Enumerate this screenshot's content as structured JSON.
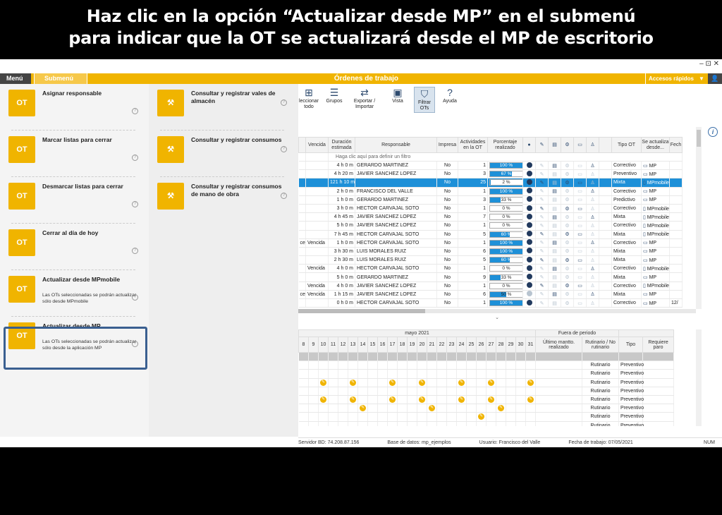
{
  "banner": {
    "line1": "Haz clic en la opción “Actualizar desde MP” en el submenú",
    "line2": "para indicar que la OT se actualizará desde el MP de escritorio"
  },
  "window": {
    "controls": "– ⊡ ✕"
  },
  "menubar": {
    "menu": "Menú",
    "submenu": "Submenú",
    "title": "Órdenes de trabajo",
    "quick": "Accesos rápidos"
  },
  "submenu": {
    "col1": [
      {
        "icon": "OT",
        "label": "Asignar responsable",
        "desc": ""
      },
      {
        "icon": "OT",
        "label": "Marcar listas para cerrar",
        "desc": ""
      },
      {
        "icon": "OT",
        "label": "Desmarcar listas para cerrar",
        "desc": ""
      },
      {
        "icon": "OT",
        "label": "Cerrar al día de hoy",
        "desc": ""
      },
      {
        "icon": "OT",
        "label": "Actualizar desde MPmobile",
        "desc": "Las OTs seleccionadas se podrán actualizar sólo desde MPmobile"
      },
      {
        "icon": "OT",
        "label": "Actualizar desde MP",
        "desc": "Las OTs seleccionadas se podrán actualizar sólo desde la aplicación MP"
      }
    ],
    "col2": [
      {
        "label": "Consultar y registrar vales de almacén"
      },
      {
        "label": "Consultar y registrar consumos"
      },
      {
        "label": "Consultar y registrar consumos de mano de obra"
      }
    ],
    "help": "?"
  },
  "toolbar": {
    "items": [
      {
        "label": "leccionar todo",
        "glyph": "⊞"
      },
      {
        "label": "Grupos",
        "glyph": "☰"
      },
      {
        "label": "Exportar / Importar",
        "glyph": "⇄"
      },
      {
        "label": "Vista",
        "glyph": "▣"
      },
      {
        "label": "Filtrar OTs",
        "glyph": "⛉"
      },
      {
        "label": "Ayuda",
        "glyph": "?"
      }
    ]
  },
  "grid": {
    "headers": [
      "Vencida",
      "Duración estimada",
      "Responsable",
      "Impresa",
      "Actividades en la OT",
      "Porcentaje realizado",
      "Tipo OT",
      "Se actualiza desde...",
      "Fech"
    ],
    "filter_text": "Haga clic aquí para definir un filtro",
    "rows": [
      {
        "pre": "",
        "venc": "",
        "dur": "4 h 0 m",
        "resp": "GERARDO MARTINEZ",
        "imp": "No",
        "act": "1",
        "pct": "100 %",
        "fill": 100,
        "tipo": "Correctivo",
        "desde": "MP",
        "fecha": ""
      },
      {
        "pre": "",
        "venc": "",
        "dur": "4 h 20 m",
        "resp": "JAVIER SANCHEZ LOPEZ",
        "imp": "No",
        "act": "3",
        "pct": "67 %",
        "fill": 67,
        "tipo": "Preventivo",
        "desde": "MP",
        "fecha": ""
      },
      {
        "pre": "",
        "venc": "",
        "dur": "121 h 10 m",
        "resp": "",
        "imp": "No",
        "act": "25",
        "pct": "2 %",
        "fill": 2,
        "tipo": "Mixta",
        "desde": "MPmobile",
        "fecha": "",
        "hl": true
      },
      {
        "pre": "",
        "venc": "",
        "dur": "2 h 0 m",
        "resp": "FRANCISCO DEL VALLE",
        "imp": "No",
        "act": "1",
        "pct": "100 %",
        "fill": 100,
        "tipo": "Correctivo",
        "desde": "MP",
        "fecha": ""
      },
      {
        "pre": "",
        "venc": "",
        "dur": "1 h 0 m",
        "resp": "GERARDO MARTINEZ",
        "imp": "No",
        "act": "3",
        "pct": "33 %",
        "fill": 33,
        "tipo": "Predictivo",
        "desde": "MP",
        "fecha": ""
      },
      {
        "pre": "",
        "venc": "",
        "dur": "3 h 0 m",
        "resp": "HECTOR CARVAJAL SOTO",
        "imp": "No",
        "act": "1",
        "pct": "0 %",
        "fill": 0,
        "tipo": "Correctivo",
        "desde": "MPmobile",
        "fecha": ""
      },
      {
        "pre": "",
        "venc": "",
        "dur": "4 h 45 m",
        "resp": "JAVIER SANCHEZ LOPEZ",
        "imp": "No",
        "act": "7",
        "pct": "0 %",
        "fill": 0,
        "tipo": "Mixta",
        "desde": "MPmobile",
        "fecha": ""
      },
      {
        "pre": "",
        "venc": "",
        "dur": "5 h 0 m",
        "resp": "JAVIER SANCHEZ LOPEZ",
        "imp": "No",
        "act": "1",
        "pct": "0 %",
        "fill": 0,
        "tipo": "Correctivo",
        "desde": "MPmobile",
        "fecha": ""
      },
      {
        "pre": "",
        "venc": "",
        "dur": "7 h 45 m",
        "resp": "HECTOR CARVAJAL SOTO",
        "imp": "No",
        "act": "5",
        "pct": "60 %",
        "fill": 60,
        "tipo": "Mixta",
        "desde": "MPmobile",
        "fecha": ""
      },
      {
        "pre": "ce",
        "venc": "Vencida",
        "dur": "1 h 0 m",
        "resp": "HECTOR CARVAJAL SOTO",
        "imp": "No",
        "act": "1",
        "pct": "100 %",
        "fill": 100,
        "tipo": "Correctivo",
        "desde": "MP",
        "fecha": ""
      },
      {
        "pre": "",
        "venc": "",
        "dur": "3 h 30 m",
        "resp": "LUIS MORALES RUIZ",
        "imp": "No",
        "act": "6",
        "pct": "100 %",
        "fill": 100,
        "tipo": "Mixta",
        "desde": "MP",
        "fecha": ""
      },
      {
        "pre": "",
        "venc": "",
        "dur": "2 h 30 m",
        "resp": "LUIS MORALES RUIZ",
        "imp": "No",
        "act": "5",
        "pct": "60 %",
        "fill": 60,
        "tipo": "Mixta",
        "desde": "MP",
        "fecha": ""
      },
      {
        "pre": "",
        "venc": "Vencida",
        "dur": "4 h 0 m",
        "resp": "HECTOR CARVAJAL SOTO",
        "imp": "No",
        "act": "1",
        "pct": "0 %",
        "fill": 0,
        "tipo": "Correctivo",
        "desde": "MPmobile",
        "fecha": ""
      },
      {
        "pre": "",
        "venc": "",
        "dur": "5 h 0 m",
        "resp": "GERARDO MARTINEZ",
        "imp": "No",
        "act": "9",
        "pct": "33 %",
        "fill": 33,
        "tipo": "Mixta",
        "desde": "MP",
        "fecha": ""
      },
      {
        "pre": "",
        "venc": "Vencida",
        "dur": "4 h 0 m",
        "resp": "JAVIER SANCHEZ LOPEZ",
        "imp": "No",
        "act": "1",
        "pct": "0 %",
        "fill": 0,
        "tipo": "Correctivo",
        "desde": "MPmobile",
        "fecha": ""
      },
      {
        "pre": "ce",
        "venc": "Vencida",
        "dur": "1 h 15 m",
        "resp": "JAVIER SANCHEZ LOPEZ",
        "imp": "No",
        "act": "6",
        "pct": "50 %",
        "fill": 50,
        "tipo": "Mixta",
        "desde": "MP",
        "fecha": ""
      },
      {
        "pre": "",
        "venc": "",
        "dur": "0 h 0 m",
        "resp": "HECTOR CARVAJAL SOTO",
        "imp": "No",
        "act": "1",
        "pct": "100 %",
        "fill": 100,
        "tipo": "Correctivo",
        "desde": "MP",
        "fecha": "12/"
      }
    ]
  },
  "calendar": {
    "month": "mayo 2021",
    "out_of_period": "Fuera de periodo",
    "days": [
      "8",
      "9",
      "10",
      "11",
      "12",
      "13",
      "14",
      "15",
      "16",
      "17",
      "18",
      "19",
      "20",
      "21",
      "22",
      "23",
      "24",
      "25",
      "26",
      "27",
      "28",
      "29",
      "30",
      "31"
    ],
    "headers": [
      "Último mantto. realizado",
      "Rutinario / No rutinario",
      "Tipo",
      "Requiere paro"
    ],
    "rows": [
      {
        "rut": "",
        "tipo": "",
        "marks": [],
        "band": true
      },
      {
        "rut": "Rutinario",
        "tipo": "Preventivo",
        "marks": []
      },
      {
        "rut": "Rutinario",
        "tipo": "Preventivo",
        "marks": []
      },
      {
        "rut": "Rutinario",
        "tipo": "Preventivo",
        "marks": [
          2,
          5,
          9,
          12,
          16,
          19,
          23
        ]
      },
      {
        "rut": "Rutinario",
        "tipo": "Preventivo",
        "marks": []
      },
      {
        "rut": "Rutinario",
        "tipo": "Preventivo",
        "marks": [
          2,
          5,
          9,
          12,
          16,
          19,
          23
        ]
      },
      {
        "rut": "Rutinario",
        "tipo": "Preventivo",
        "marks": [
          6,
          13,
          20
        ]
      },
      {
        "rut": "Rutinario",
        "tipo": "Preventivo",
        "marks": [
          18
        ]
      },
      {
        "rut": "Rutinario",
        "tipo": "Preventivo",
        "marks": []
      }
    ]
  },
  "statusbar": {
    "server": "Servidor BD: 74.208.87.156",
    "db": "Base de datos: mp_ejemplos",
    "user": "Usuario: Francisco del Valle",
    "date": "Fecha de trabajo: 07/05/2021",
    "num": "NUM"
  }
}
